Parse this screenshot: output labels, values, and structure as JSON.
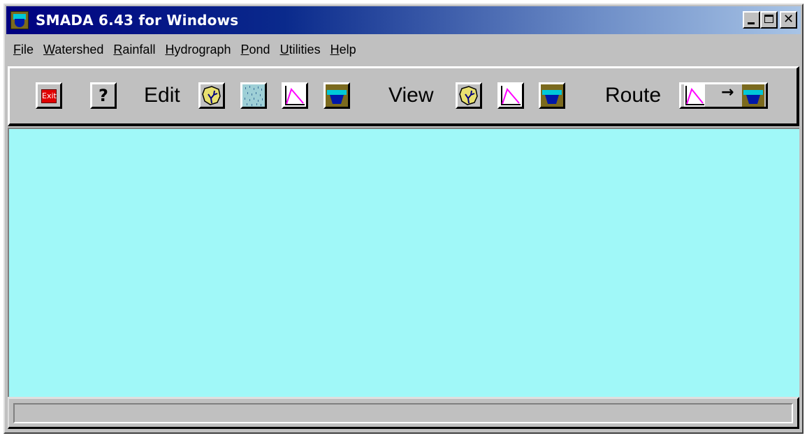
{
  "window": {
    "title": "SMADA 6.43 for Windows"
  },
  "menu": [
    {
      "pre": "",
      "acc": "F",
      "post": "ile"
    },
    {
      "pre": "",
      "acc": "W",
      "post": "atershed"
    },
    {
      "pre": "",
      "acc": "R",
      "post": "ainfall"
    },
    {
      "pre": "",
      "acc": "H",
      "post": "ydrograph"
    },
    {
      "pre": "",
      "acc": "P",
      "post": "ond"
    },
    {
      "pre": "",
      "acc": "U",
      "post": "tilities"
    },
    {
      "pre": "",
      "acc": "H",
      "post": "elp"
    }
  ],
  "toolbar": {
    "exit_label": "Exit",
    "help_label": "?",
    "edit_label": "Edit",
    "view_label": "View",
    "route_label": "Route",
    "route_arrow": "→"
  },
  "status": {
    "text": ""
  },
  "colors": {
    "client_bg": "#a0f8f8",
    "exit_red": "#e00000",
    "water": "#00c8d8",
    "pond": "#0018a8",
    "hydrograph_line": "#ff00ff"
  }
}
